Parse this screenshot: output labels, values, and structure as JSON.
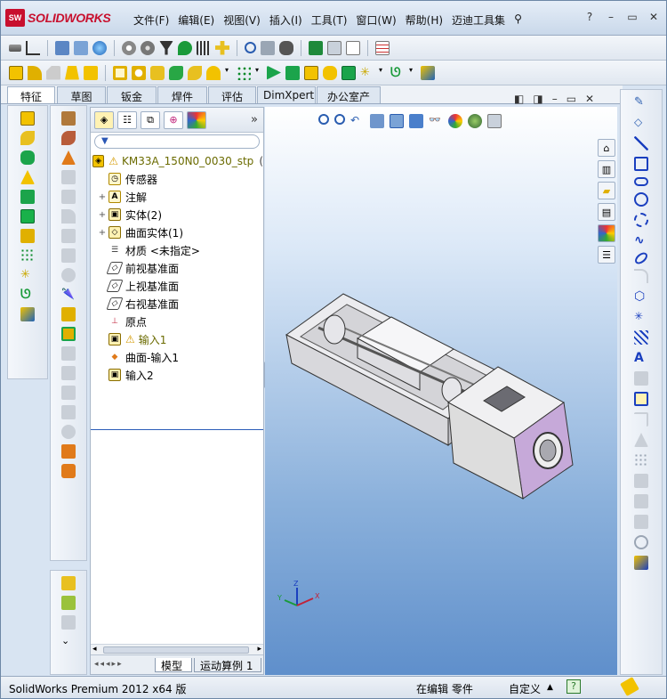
{
  "app": {
    "logo_text": "SOLIDWORKS",
    "menu": [
      "文件(F)",
      "编辑(E)",
      "视图(V)",
      "插入(I)",
      "工具(T)",
      "窗口(W)",
      "帮助(H)",
      "迈迪工具集"
    ],
    "title_controls": [
      "?",
      "–",
      "▭",
      "✕"
    ]
  },
  "command_tabs": [
    "特征",
    "草图",
    "钣金",
    "焊件",
    "评估",
    "DimXpert",
    "办公室产品"
  ],
  "feature_manager": {
    "tabs": [
      "feature-manager-tab",
      "property-manager-tab",
      "configuration-manager-tab",
      "dimxpert-manager-tab",
      "display-manager-tab"
    ],
    "more_label": "»",
    "root": {
      "label": "KM33A_150N0_0030_stp",
      "suffix": "("
    },
    "items": [
      {
        "label": "传感器",
        "expand": "",
        "icon": "sensor-icon"
      },
      {
        "label": "注解",
        "expand": "+",
        "icon": "annotation-icon"
      },
      {
        "label": "实体(2)",
        "expand": "+",
        "icon": "solid-bodies-icon"
      },
      {
        "label": "曲面实体(1)",
        "expand": "+",
        "icon": "surface-bodies-icon"
      },
      {
        "label": "材质 <未指定>",
        "expand": "",
        "icon": "material-icon"
      },
      {
        "label": "前视基准面",
        "expand": "",
        "icon": "plane-icon"
      },
      {
        "label": "上视基准面",
        "expand": "",
        "icon": "plane-icon"
      },
      {
        "label": "右视基准面",
        "expand": "",
        "icon": "plane-icon"
      },
      {
        "label": "原点",
        "expand": "",
        "icon": "origin-icon"
      },
      {
        "label": "输入1",
        "expand": "",
        "icon": "import-icon",
        "warning": true
      },
      {
        "label": "曲面-输入1",
        "expand": "",
        "icon": "surface-import-icon"
      },
      {
        "label": "输入2",
        "expand": "",
        "icon": "import-icon"
      }
    ],
    "bottom_tabs": [
      "模型",
      "运动算例 1"
    ]
  },
  "status_bar": {
    "left": "SolidWorks Premium 2012 x64 版",
    "editing": "在编辑 零件",
    "units": "自定义",
    "units_arrow": "▲"
  },
  "colors": {
    "brand_red": "#c8102e",
    "accent_yellow": "#f2c200",
    "viewport_bottom": "#5f8fcb",
    "part_face": "#e4e4e6",
    "part_mauve": "#c6a9d9"
  }
}
